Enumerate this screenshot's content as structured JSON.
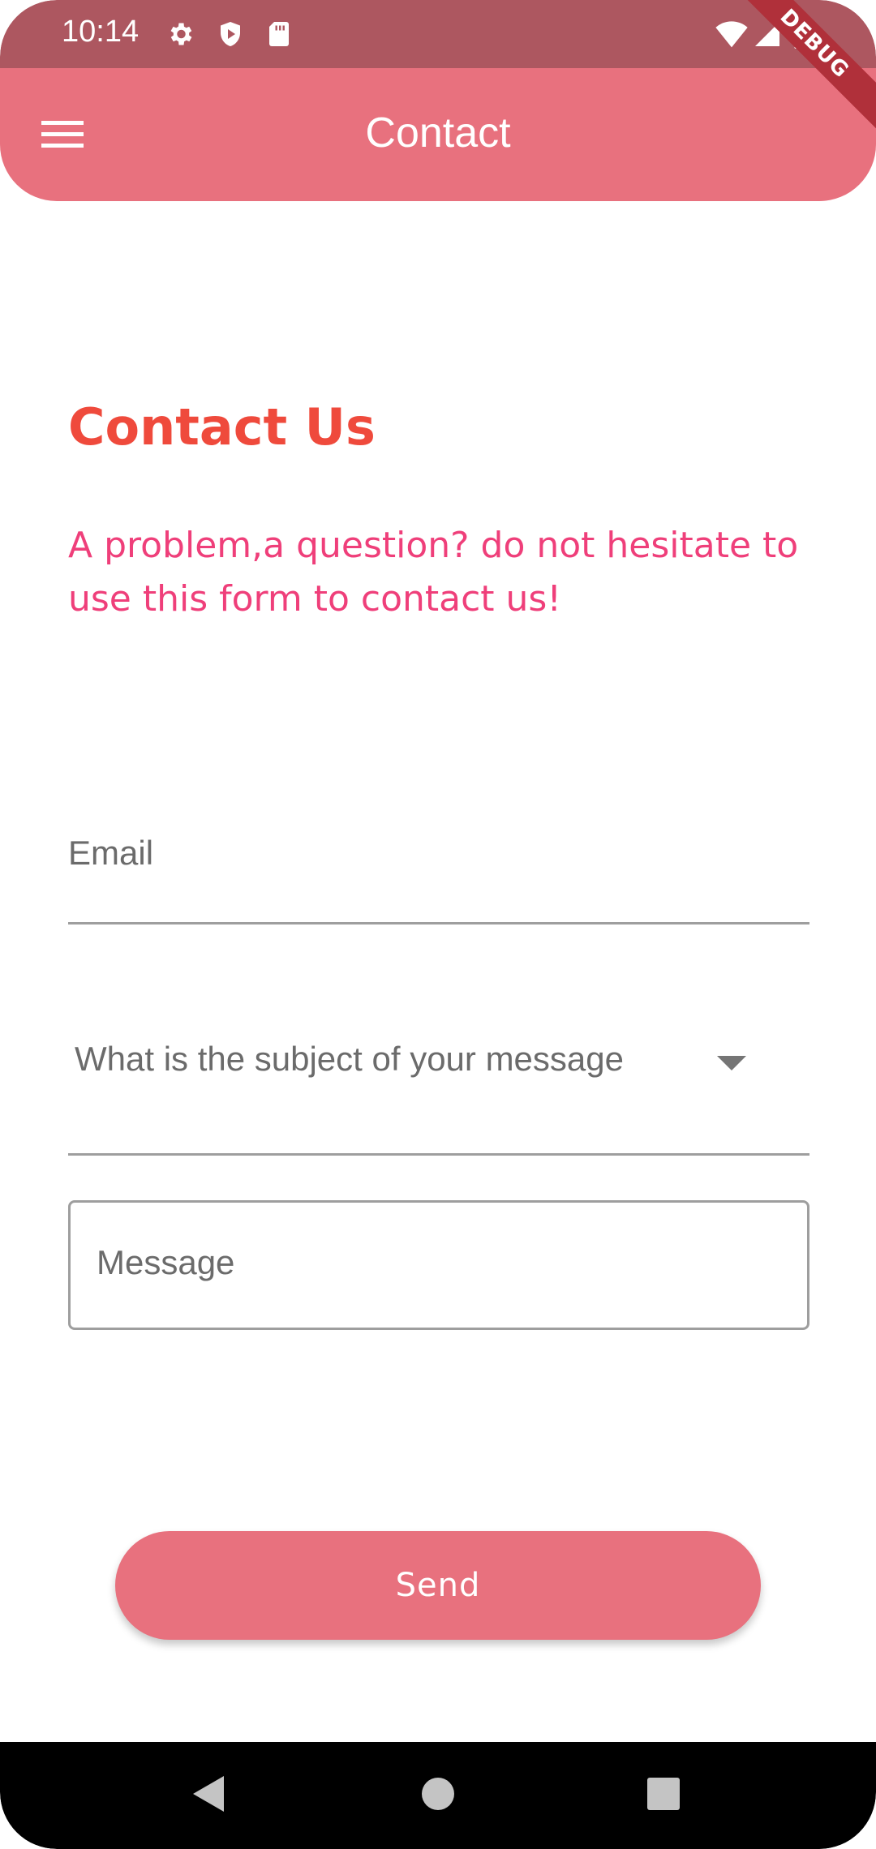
{
  "status_bar": {
    "time": "10:14",
    "left_icons": [
      "settings-icon",
      "shield-play-icon",
      "sd-card-icon"
    ],
    "right_icons": [
      "wifi-icon",
      "signal-icon",
      "battery-icon"
    ]
  },
  "debug_banner": {
    "label": "DEBUG"
  },
  "app_bar": {
    "title": "Contact",
    "menu_icon": "hamburger-menu-icon",
    "background_color": "#e8717e"
  },
  "content": {
    "heading": "Contact Us",
    "subtitle": "A problem,a question? do not hesitate to use this form to contact us!",
    "heading_color": "#ef4a3c",
    "subtitle_color": "#ef3f7a"
  },
  "form": {
    "email_placeholder": "Email",
    "subject_placeholder": "What is the subject of your message",
    "message_placeholder": "Message",
    "send_label": "Send"
  },
  "nav_bar": {
    "icons": [
      "back-icon",
      "home-icon",
      "recents-icon"
    ]
  }
}
